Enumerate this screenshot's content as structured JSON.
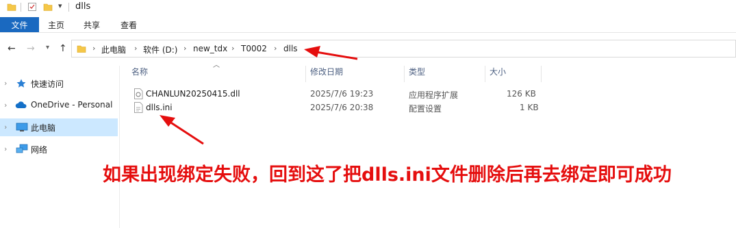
{
  "window": {
    "title": "dlls"
  },
  "ribbon": {
    "tabs": [
      "文件",
      "主页",
      "共享",
      "查看"
    ]
  },
  "navigation": {
    "breadcrumb": [
      "此电脑",
      "软件 (D:)",
      "new_tdx",
      "T0002",
      "dlls"
    ]
  },
  "sidebar": {
    "items": [
      {
        "label": "快速访问",
        "icon": "star-icon"
      },
      {
        "label": "OneDrive - Personal",
        "icon": "cloud-icon"
      },
      {
        "label": "此电脑",
        "icon": "monitor-icon",
        "selected": true
      },
      {
        "label": "网络",
        "icon": "network-icon"
      }
    ]
  },
  "file_list": {
    "columns": [
      "名称",
      "修改日期",
      "类型",
      "大小"
    ],
    "rows": [
      {
        "name": "CHANLUN20250415.dll",
        "modified": "2025/7/6 19:23",
        "type": "应用程序扩展",
        "size": "126 KB",
        "icon": "dll-file-icon"
      },
      {
        "name": "dlls.ini",
        "modified": "2025/7/6 20:38",
        "type": "配置设置",
        "size": "1 KB",
        "icon": "ini-file-icon"
      }
    ]
  },
  "annotation": {
    "text": "如果出现绑定失败，回到这了把dlls.ini文件删除后再去绑定即可成功",
    "color": "#e50e0e"
  },
  "colors": {
    "accent": "#1a69c0",
    "selection": "#cce8ff",
    "folder": "#f5c748"
  }
}
